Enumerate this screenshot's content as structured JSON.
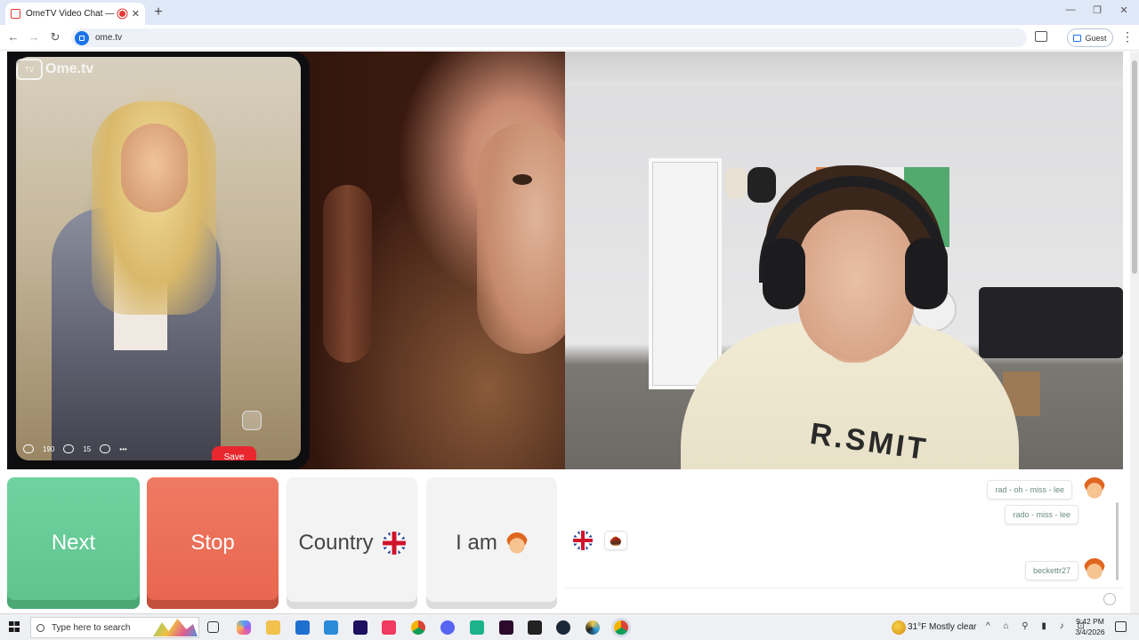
{
  "browser": {
    "tab_title": "OmeTV Video Chat — Ome",
    "tab_close": "✕",
    "new_tab": "+",
    "url": "ome.tv",
    "profile_label": "Guest",
    "window_minimize": "—",
    "window_restore": "❐",
    "window_close": "✕",
    "nav_back": "←",
    "nav_forward": "→",
    "nav_reload": "↻",
    "menu": "⋮"
  },
  "video": {
    "logo_icon_text": "Ome\nTV",
    "logo_text": "Ome.tv",
    "phone_save_label": "Save",
    "phone_likes": "190",
    "phone_comments": "15",
    "phone_dots": "•••",
    "shirt_print": "R.SMIT"
  },
  "controls": {
    "next_label": "Next",
    "stop_label": "Stop",
    "country_label": "Country",
    "iam_label": "I am"
  },
  "chat": {
    "messages": [
      {
        "text": "rad - oh - miss - lee"
      },
      {
        "text": "rado - miss - lee"
      },
      {
        "text": "beckettr27"
      }
    ],
    "sticker": "🌰"
  },
  "taskbar": {
    "search_placeholder": "Type here to search",
    "weather_temp": "31°F",
    "weather_desc": "Mostly clear",
    "tray": "^ ⌂ ⚲ ▮ ♪ ⊡",
    "time": "9:42 PM",
    "date": "3/4/2026"
  },
  "colors": {
    "next_button": "#5fc28e",
    "stop_button": "#e8654e",
    "neutral_button": "#f3f3f3",
    "chat_text": "#6a8a80",
    "tabstrip": "#dfe8f7"
  }
}
